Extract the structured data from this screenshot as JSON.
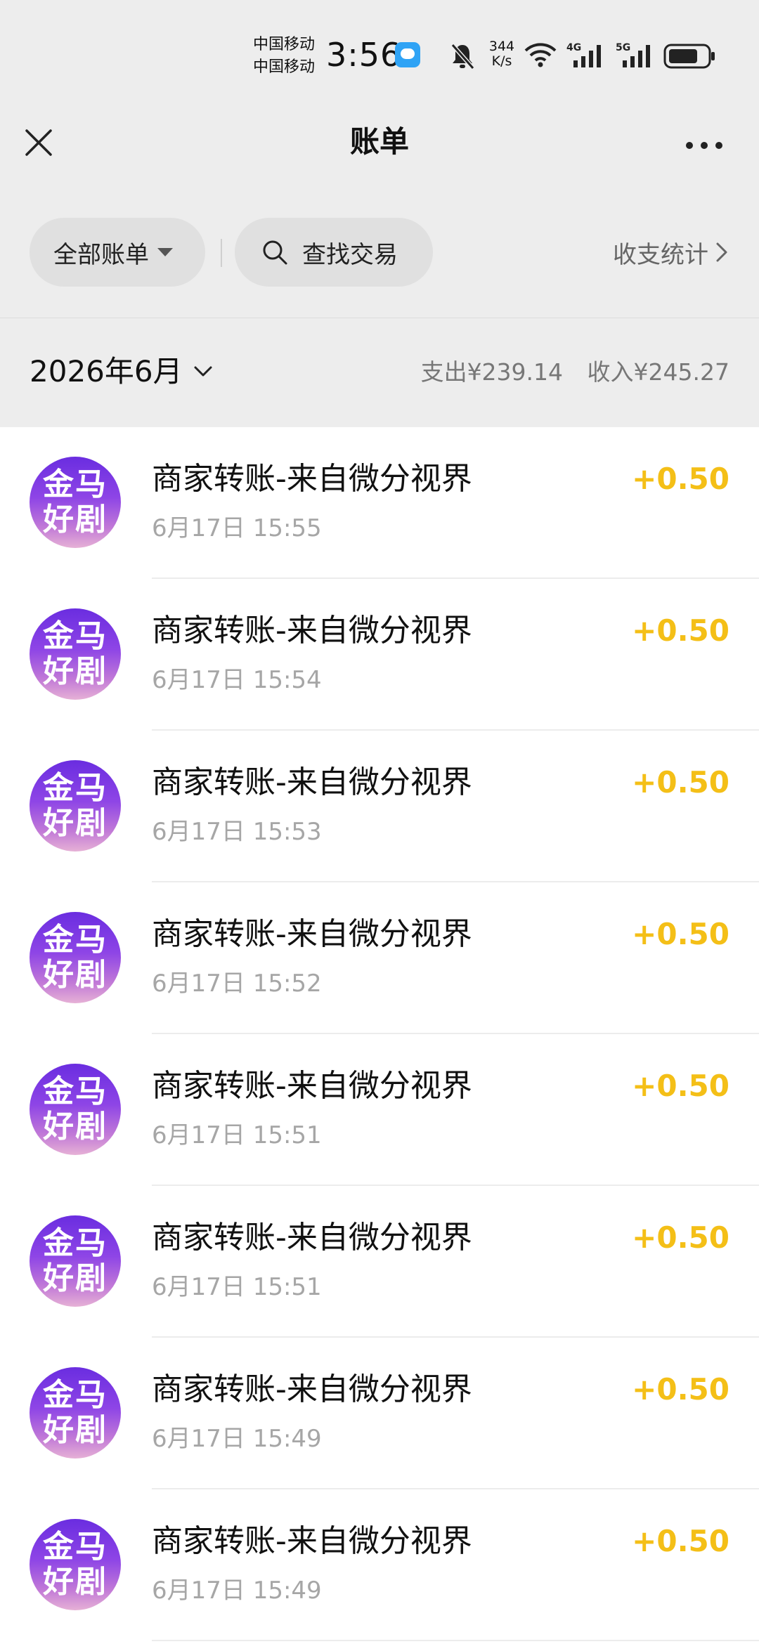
{
  "status_bar": {
    "carrier_1": "中国移动",
    "carrier_2": "中国移动",
    "time": "3:56",
    "speed_value": "344",
    "speed_unit": "K/s",
    "icons": [
      "message-icon",
      "bell-off-icon",
      "wifi-icon",
      "signal-4g-icon",
      "signal-5g-icon",
      "battery-icon"
    ]
  },
  "header": {
    "title": "账单",
    "icons": [
      "close-icon",
      "more-icon"
    ]
  },
  "filters": {
    "all_bills_label": "全部账单",
    "search_label": "查找交易",
    "stats_label": "收支统计",
    "icons": [
      "caret-down-icon",
      "search-icon",
      "chevron-right-icon"
    ]
  },
  "month_summary": {
    "month": "2026年6月",
    "expense": "支出¥239.14",
    "income": "收入¥245.27",
    "icons": [
      "chevron-down-icon"
    ]
  },
  "transactions": [
    {
      "avatar_line1": "金马",
      "avatar_line2": "好剧",
      "title": "商家转账-来自微分视界",
      "time": "6月17日 15:55",
      "amount": "+0.50"
    },
    {
      "avatar_line1": "金马",
      "avatar_line2": "好剧",
      "title": "商家转账-来自微分视界",
      "time": "6月17日 15:54",
      "amount": "+0.50"
    },
    {
      "avatar_line1": "金马",
      "avatar_line2": "好剧",
      "title": "商家转账-来自微分视界",
      "time": "6月17日 15:53",
      "amount": "+0.50"
    },
    {
      "avatar_line1": "金马",
      "avatar_line2": "好剧",
      "title": "商家转账-来自微分视界",
      "time": "6月17日 15:52",
      "amount": "+0.50"
    },
    {
      "avatar_line1": "金马",
      "avatar_line2": "好剧",
      "title": "商家转账-来自微分视界",
      "time": "6月17日 15:51",
      "amount": "+0.50"
    },
    {
      "avatar_line1": "金马",
      "avatar_line2": "好剧",
      "title": "商家转账-来自微分视界",
      "time": "6月17日 15:51",
      "amount": "+0.50"
    },
    {
      "avatar_line1": "金马",
      "avatar_line2": "好剧",
      "title": "商家转账-来自微分视界",
      "time": "6月17日 15:49",
      "amount": "+0.50"
    },
    {
      "avatar_line1": "金马",
      "avatar_line2": "好剧",
      "title": "商家转账-来自微分视界",
      "time": "6月17日 15:49",
      "amount": "+0.50"
    }
  ],
  "colors": {
    "background": "#ededed",
    "list_background": "#ffffff",
    "income_amount": "#f4bf17",
    "secondary_text": "#a6a6a6",
    "avatar_gradient_top": "#6a2de0",
    "avatar_gradient_bottom": "#e6b1d6"
  }
}
